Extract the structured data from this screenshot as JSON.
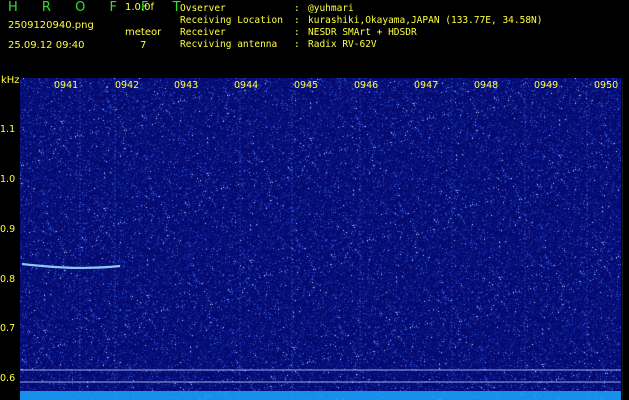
{
  "header": {
    "app_title": "H R O F F T",
    "version": "1.0.0f",
    "filename": "2509120940.png",
    "datetime": "25.09.12 09:40",
    "meteor_label": "meteor",
    "meteor_count": "7"
  },
  "info": {
    "rows": [
      {
        "key": "Ovserver",
        "value": "@yuhmari"
      },
      {
        "key": "Receiving Location",
        "value": "kurashiki,Okayama,JAPAN (133.77E, 34.58N)"
      },
      {
        "key": "Receiver",
        "value": "NESDR SMArt + HDSDR"
      },
      {
        "key": "Recviving antenna",
        "value": "Radix RV-62V"
      }
    ]
  },
  "axis": {
    "unit": "kHz",
    "y_ticks": [
      "1.1",
      "1.0",
      "0.9",
      "0.8",
      "0.7",
      "0.6"
    ],
    "x_ticks": [
      "0941",
      "0942",
      "0943",
      "0944",
      "0945",
      "0946",
      "0947",
      "0948",
      "0949",
      "0950"
    ]
  },
  "colors": {
    "background": "#050a70",
    "label": "#ffff40",
    "title": "#2fe02f"
  }
}
